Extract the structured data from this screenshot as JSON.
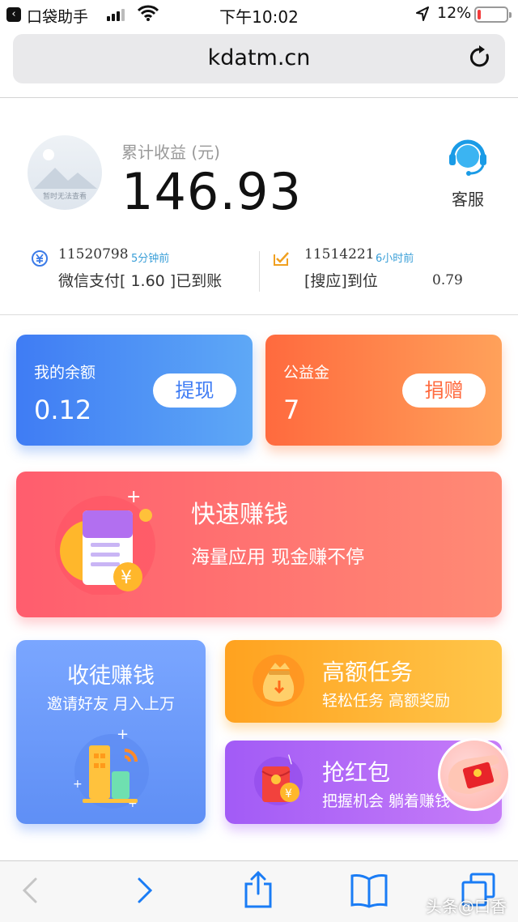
{
  "status_bar": {
    "back_app": "口袋助手",
    "time": "下午10:02",
    "battery": "12%",
    "battery_level": 0.12
  },
  "browser": {
    "url": "kdatm.cn"
  },
  "earnings": {
    "avatar_caption": "暂时无法查看",
    "label": "累计收益 (元)",
    "value": "146.93",
    "service_label": "客服"
  },
  "ticker": [
    {
      "id": "11520798",
      "ago": "5分钟前",
      "message": "微信支付[ 1.60 ]已到账",
      "amount": ""
    },
    {
      "id": "11514221",
      "ago": "6小时前",
      "message": "[搜应]到位",
      "amount": "0.79"
    }
  ],
  "cards": {
    "balance": {
      "title": "我的余额",
      "value": "0.12",
      "action": "提现"
    },
    "welfare": {
      "title": "公益金",
      "value": "7",
      "action": "捐赠"
    },
    "fast": {
      "title": "快速赚钱",
      "subtitle": "海量应用 现金赚不停"
    },
    "invite": {
      "title": "收徒赚钱",
      "subtitle": "邀请好友 月入上万"
    },
    "task": {
      "title": "高额任务",
      "subtitle": "轻松任务 高额奖励"
    },
    "packet": {
      "title": "抢红包",
      "subtitle": "把握机会 躺着赚钱"
    }
  },
  "toolbar": {
    "icons": [
      "back-arrow-icon",
      "forward-arrow-icon",
      "share-icon",
      "bookmarks-icon",
      "tabs-icon"
    ]
  },
  "watermark": "头条@口香",
  "colors": {
    "balance": "#3f7cf4",
    "welfare": "#ff6a3e",
    "fast": "#ff5d6e",
    "invite": "#6f9cfa",
    "task": "#ffa21f",
    "packet": "#a25bf6",
    "link": "#1a7cf5"
  }
}
